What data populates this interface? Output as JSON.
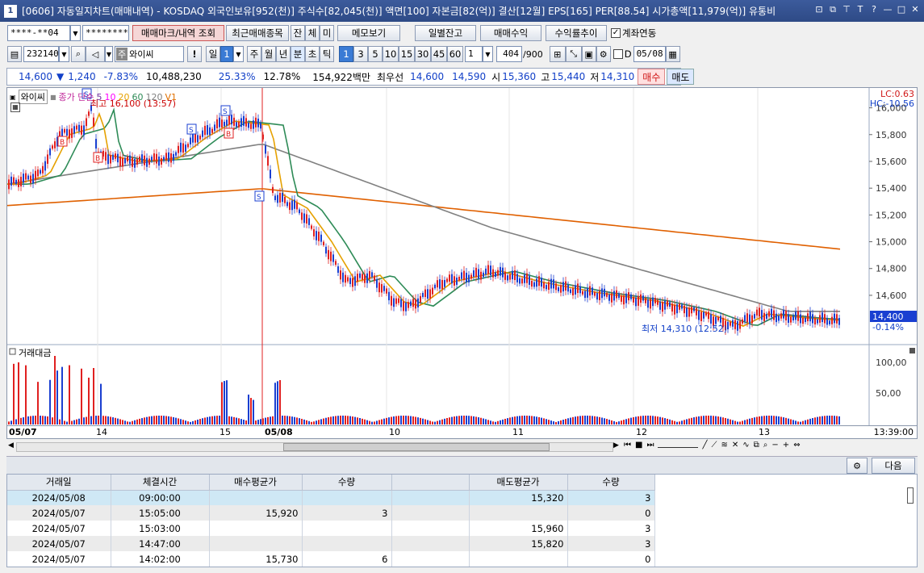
{
  "window": {
    "num": "1",
    "title": "[0606] 자동일지차트(매매내역) - KOSDAQ 외국인보유[952(천)] 주식수[82,045(천)] 액면[100] 자본금[82(억)] 결산[12월] EPS[165] PER[88.54] 시가총액[11,979(억)] 유통비"
  },
  "toolbar1": {
    "account": "****-**04",
    "password": "*********",
    "btn_marks": "매매마크/내역 조회",
    "btn_recent": "최근매매종목",
    "btn_jan": "잔",
    "btn_che": "체",
    "btn_mi": "미",
    "btn_memo": "메모보기",
    "btn_daily": "일별잔고",
    "btn_profit": "매매수익",
    "btn_rate": "수익률추이",
    "chk_link": "계좌연동"
  },
  "toolbar2": {
    "code": "232140",
    "name_tag": "주",
    "name": "와이씨",
    "excl": "!",
    "period": [
      "일",
      "1",
      "주",
      "월",
      "년",
      "분",
      "초",
      "틱"
    ],
    "minutes": [
      "1",
      "3",
      "5",
      "10",
      "15",
      "30",
      "45",
      "60"
    ],
    "unit": "1",
    "count": "404",
    "count_max": "/900",
    "d_label": "D",
    "date": "05/08"
  },
  "quote": {
    "price": "14,600",
    "arrow": "▼",
    "change": "1,240",
    "pct": "-7.83%",
    "volume": "10,488,230",
    "ratio1": "25.33%",
    "ratio2": "12.78%",
    "amount": "154,922백만",
    "best_label": "최우선",
    "ask": "14,600",
    "bid": "14,590",
    "open_label": "시",
    "open": "15,360",
    "high_label": "고",
    "high": "15,440",
    "low_label": "저",
    "low": "14,310",
    "buy": "매수",
    "sell": "매도"
  },
  "chart": {
    "legend_name": "와이씨",
    "legend_close": "종가 단순",
    "ma": [
      "5",
      "10",
      "20",
      "60",
      "120"
    ],
    "ma_colors": [
      "#7030a0",
      "#ff00ff",
      "#e6a100",
      "#2e8b57",
      "#808080"
    ],
    "v1_label": "V1",
    "high_ann": "최고 16,100 (13:57)",
    "low_ann": "최저 14,310 (12:52)",
    "lc": "LC:0.63",
    "hc": "HC:-10.56",
    "price_axis": [
      "16,000",
      "15,800",
      "15,600",
      "15,400",
      "15,200",
      "15,000",
      "14,800",
      "14,600"
    ],
    "current_price": "14,400",
    "current_pct": "-0.14%",
    "vol_title": "거래대금",
    "vol_axis": [
      "100,00",
      "50,00"
    ],
    "time": "13:39:00",
    "dates": [
      "05/07",
      "14",
      "15",
      "05/08",
      "10",
      "11",
      "12",
      "13"
    ]
  },
  "bottom": {
    "next": "다음"
  },
  "table": {
    "headers": [
      "거래일",
      "체결시간",
      "매수평균가",
      "수량",
      "",
      "매도평균가",
      "수량"
    ],
    "rows": [
      [
        "2024/05/08",
        "09:00:00",
        "",
        "",
        "",
        "15,320",
        "3"
      ],
      [
        "2024/05/07",
        "15:05:00",
        "15,920",
        "3",
        "",
        "",
        "0"
      ],
      [
        "2024/05/07",
        "15:03:00",
        "",
        "",
        "",
        "15,960",
        "3"
      ],
      [
        "2024/05/07",
        "14:47:00",
        "",
        "",
        "",
        "15,820",
        "3"
      ],
      [
        "2024/05/07",
        "14:02:00",
        "15,730",
        "6",
        "",
        "",
        "0"
      ]
    ]
  }
}
